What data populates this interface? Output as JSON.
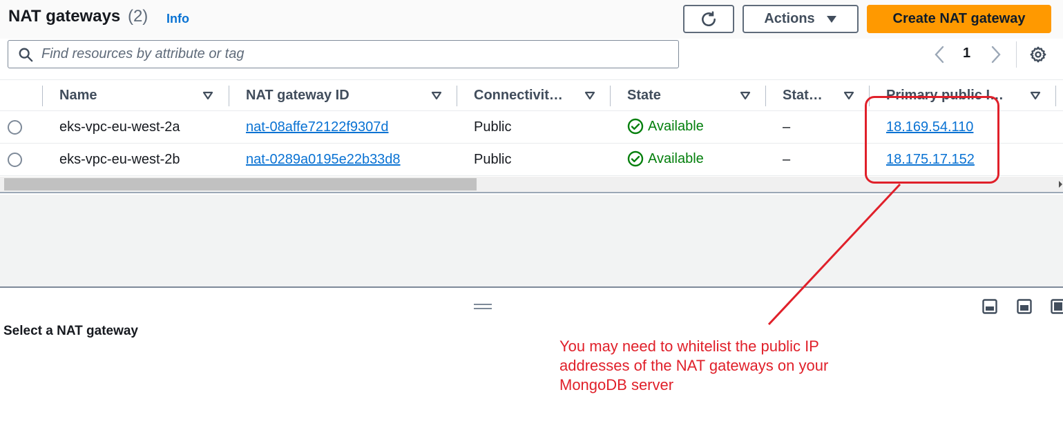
{
  "header": {
    "title": "NAT gateways",
    "count": "(2)",
    "info_label": "Info",
    "actions_label": "Actions",
    "create_label": "Create NAT gateway"
  },
  "search": {
    "placeholder": "Find resources by attribute or tag",
    "value": ""
  },
  "pagination": {
    "current_page": "1"
  },
  "table": {
    "columns": [
      {
        "label": "Name"
      },
      {
        "label": "NAT gateway ID"
      },
      {
        "label": "Connectivit…"
      },
      {
        "label": "State"
      },
      {
        "label": "Stat…"
      },
      {
        "label": "Primary public I…"
      }
    ],
    "rows": [
      {
        "name": "eks-vpc-eu-west-2a",
        "id": "nat-08affe72122f9307d",
        "connectivity": "Public",
        "state": "Available",
        "state_message": "–",
        "public_ip": "18.169.54.110"
      },
      {
        "name": "eks-vpc-eu-west-2b",
        "id": "nat-0289a0195e22b33d8",
        "connectivity": "Public",
        "state": "Available",
        "state_message": "–",
        "public_ip": "18.175.17.152"
      }
    ]
  },
  "split_panel": {
    "title": "Select a NAT gateway"
  },
  "annotation": {
    "line1": "You may need to whitelist the public IP",
    "line2": "addresses of the NAT gateways on your",
    "line3": "MongoDB server"
  },
  "colors": {
    "primary_button": "#ff9900",
    "link": "#0972d3",
    "success": "#037f0c",
    "annotation": "#e0202a"
  },
  "icons": [
    "refresh-icon",
    "caret-down-icon",
    "search-icon",
    "chevron-left-icon",
    "chevron-right-icon",
    "gear-icon",
    "sort-caret-icon",
    "check-circle-icon",
    "drag-handle-icon",
    "panel-position-icon"
  ]
}
